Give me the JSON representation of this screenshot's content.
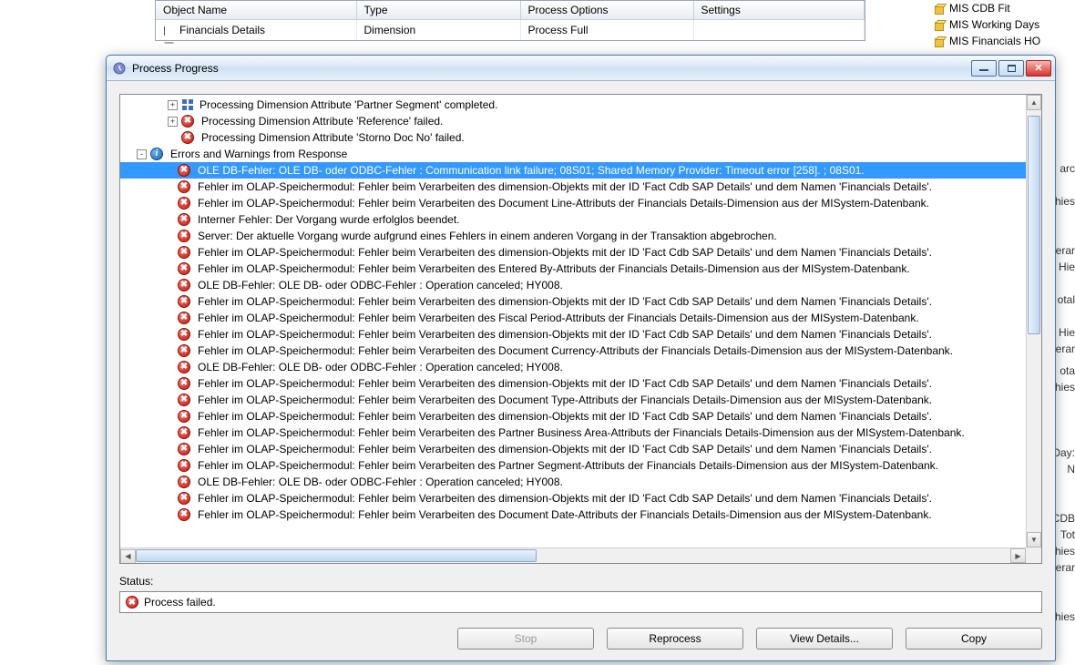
{
  "bg_table": {
    "headers": [
      "Object Name",
      "Type",
      "Process Options",
      "Settings"
    ],
    "row": {
      "name": "Financials Details",
      "type": "Dimension",
      "options": "Process Full",
      "settings": ""
    }
  },
  "side_items": [
    "MIS CDB Fit",
    "MIS Working Days",
    "MIS Financials HO"
  ],
  "bg_fragments": [
    "arc",
    "hies",
    "erar",
    "Hie",
    "otal",
    "Hie",
    "erar",
    "ota",
    "hies",
    "Day:",
    "N",
    "CDB",
    "Tot",
    "hies",
    "erar",
    "hies"
  ],
  "window": {
    "title": "Process Progress",
    "status_label": "Status:",
    "status_text": "Process failed.",
    "buttons": {
      "stop": "Stop",
      "reprocess": "Reprocess",
      "view_details": "View Details...",
      "copy": "Copy"
    }
  },
  "tree": {
    "pre_items": [
      {
        "toggle": "+",
        "icon": "group",
        "text": "Processing Dimension Attribute 'Partner Segment' completed."
      },
      {
        "toggle": "+",
        "icon": "error",
        "text": "Processing Dimension Attribute 'Reference' failed."
      },
      {
        "toggle": "",
        "icon": "error",
        "text": "Processing Dimension Attribute 'Storno Doc No' failed."
      }
    ],
    "errors_header": {
      "toggle": "-",
      "icon": "info",
      "text": "Errors and Warnings from Response"
    },
    "selected": "OLE DB-Fehler: OLE DB- oder ODBC-Fehler : Communication link failure; 08S01; Shared Memory Provider: Timeout error [258]. ; 08S01.",
    "errors": [
      "Fehler im OLAP-Speichermodul: Fehler beim Verarbeiten des dimension-Objekts mit der ID 'Fact Cdb SAP Details' und dem Namen 'Financials Details'.",
      "Fehler im OLAP-Speichermodul: Fehler beim Verarbeiten des Document Line-Attributs der Financials Details-Dimension aus der MISystem-Datenbank.",
      "Interner Fehler: Der Vorgang wurde erfolglos beendet.",
      "Server: Der aktuelle Vorgang wurde aufgrund eines Fehlers in einem anderen Vorgang in der Transaktion abgebrochen.",
      "Fehler im OLAP-Speichermodul: Fehler beim Verarbeiten des dimension-Objekts mit der ID 'Fact Cdb SAP Details' und dem Namen 'Financials Details'.",
      "Fehler im OLAP-Speichermodul: Fehler beim Verarbeiten des Entered By-Attributs der Financials Details-Dimension aus der MISystem-Datenbank.",
      "OLE DB-Fehler: OLE DB- oder ODBC-Fehler : Operation canceled; HY008.",
      "Fehler im OLAP-Speichermodul: Fehler beim Verarbeiten des dimension-Objekts mit der ID 'Fact Cdb SAP Details' und dem Namen 'Financials Details'.",
      "Fehler im OLAP-Speichermodul: Fehler beim Verarbeiten des Fiscal Period-Attributs der Financials Details-Dimension aus der MISystem-Datenbank.",
      "Fehler im OLAP-Speichermodul: Fehler beim Verarbeiten des dimension-Objekts mit der ID 'Fact Cdb SAP Details' und dem Namen 'Financials Details'.",
      "Fehler im OLAP-Speichermodul: Fehler beim Verarbeiten des Document Currency-Attributs der Financials Details-Dimension aus der MISystem-Datenbank.",
      "OLE DB-Fehler: OLE DB- oder ODBC-Fehler : Operation canceled; HY008.",
      "Fehler im OLAP-Speichermodul: Fehler beim Verarbeiten des dimension-Objekts mit der ID 'Fact Cdb SAP Details' und dem Namen 'Financials Details'.",
      "Fehler im OLAP-Speichermodul: Fehler beim Verarbeiten des Document Type-Attributs der Financials Details-Dimension aus der MISystem-Datenbank.",
      "Fehler im OLAP-Speichermodul: Fehler beim Verarbeiten des dimension-Objekts mit der ID 'Fact Cdb SAP Details' und dem Namen 'Financials Details'.",
      "Fehler im OLAP-Speichermodul: Fehler beim Verarbeiten des Partner Business Area-Attributs der Financials Details-Dimension aus der MISystem-Datenbank.",
      "Fehler im OLAP-Speichermodul: Fehler beim Verarbeiten des dimension-Objekts mit der ID 'Fact Cdb SAP Details' und dem Namen 'Financials Details'.",
      "Fehler im OLAP-Speichermodul: Fehler beim Verarbeiten des Partner Segment-Attributs der Financials Details-Dimension aus der MISystem-Datenbank.",
      "OLE DB-Fehler: OLE DB- oder ODBC-Fehler : Operation canceled; HY008.",
      "Fehler im OLAP-Speichermodul: Fehler beim Verarbeiten des dimension-Objekts mit der ID 'Fact Cdb SAP Details' und dem Namen 'Financials Details'.",
      "Fehler im OLAP-Speichermodul: Fehler beim Verarbeiten des Document Date-Attributs der Financials Details-Dimension aus der MISystem-Datenbank."
    ]
  }
}
